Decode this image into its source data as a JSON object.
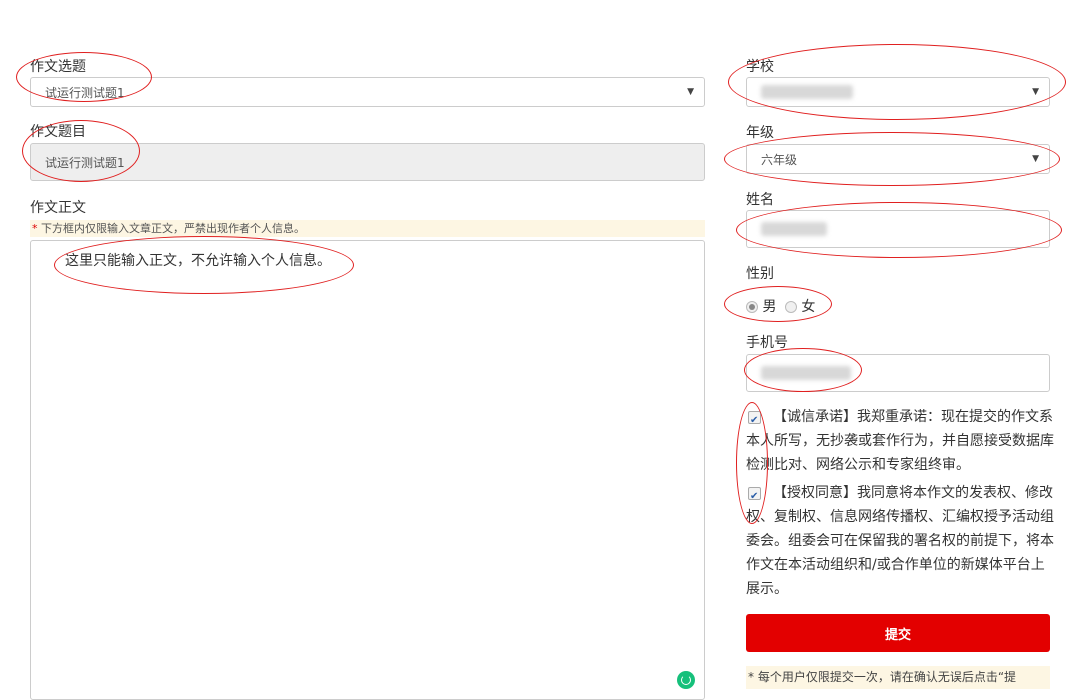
{
  "left": {
    "topic_label": "作文选题",
    "topic_value": "试运行测试题1",
    "title_label": "作文题目",
    "title_value": "试运行测试题1",
    "body_label": "作文正文",
    "warning_star": "*",
    "warning_text": " 下方框内仅限输入文章正文，严禁出现作者个人信息。",
    "body_placeholder": "这里只能输入正文，不允许输入个人信息。"
  },
  "right": {
    "school_label": "学校",
    "grade_label": "年级",
    "grade_value": "六年级",
    "name_label": "姓名",
    "gender_label": "性别",
    "gender_male": "男",
    "gender_female": "女",
    "phone_label": "手机号",
    "integrity_pledge": "【诚信承诺】我郑重承诺：现在提交的作文系本人所写，无抄袭或套作行为，并自愿接受数据库检测比对、网络公示和专家组终审。",
    "authorization": "【授权同意】我同意将本作文的发表权、修改权、复制权、信息网络传播权、汇编权授予活动组委会。组委会可在保留我的署名权的前提下，将本作文在本活动组织和/或合作单位的新媒体平台上展示。",
    "submit_label": "提交",
    "note_text": "* 每个用户仅限提交一次，请在确认无误后点击“提"
  },
  "icons": {
    "dropdown": "chevron-down-icon",
    "grammar": "grammar-check-icon"
  },
  "colors": {
    "annotation_red": "#e02020",
    "submit_red": "#e30000",
    "grammar_green": "#16c07b",
    "warning_bg": "#fdf6e3"
  }
}
